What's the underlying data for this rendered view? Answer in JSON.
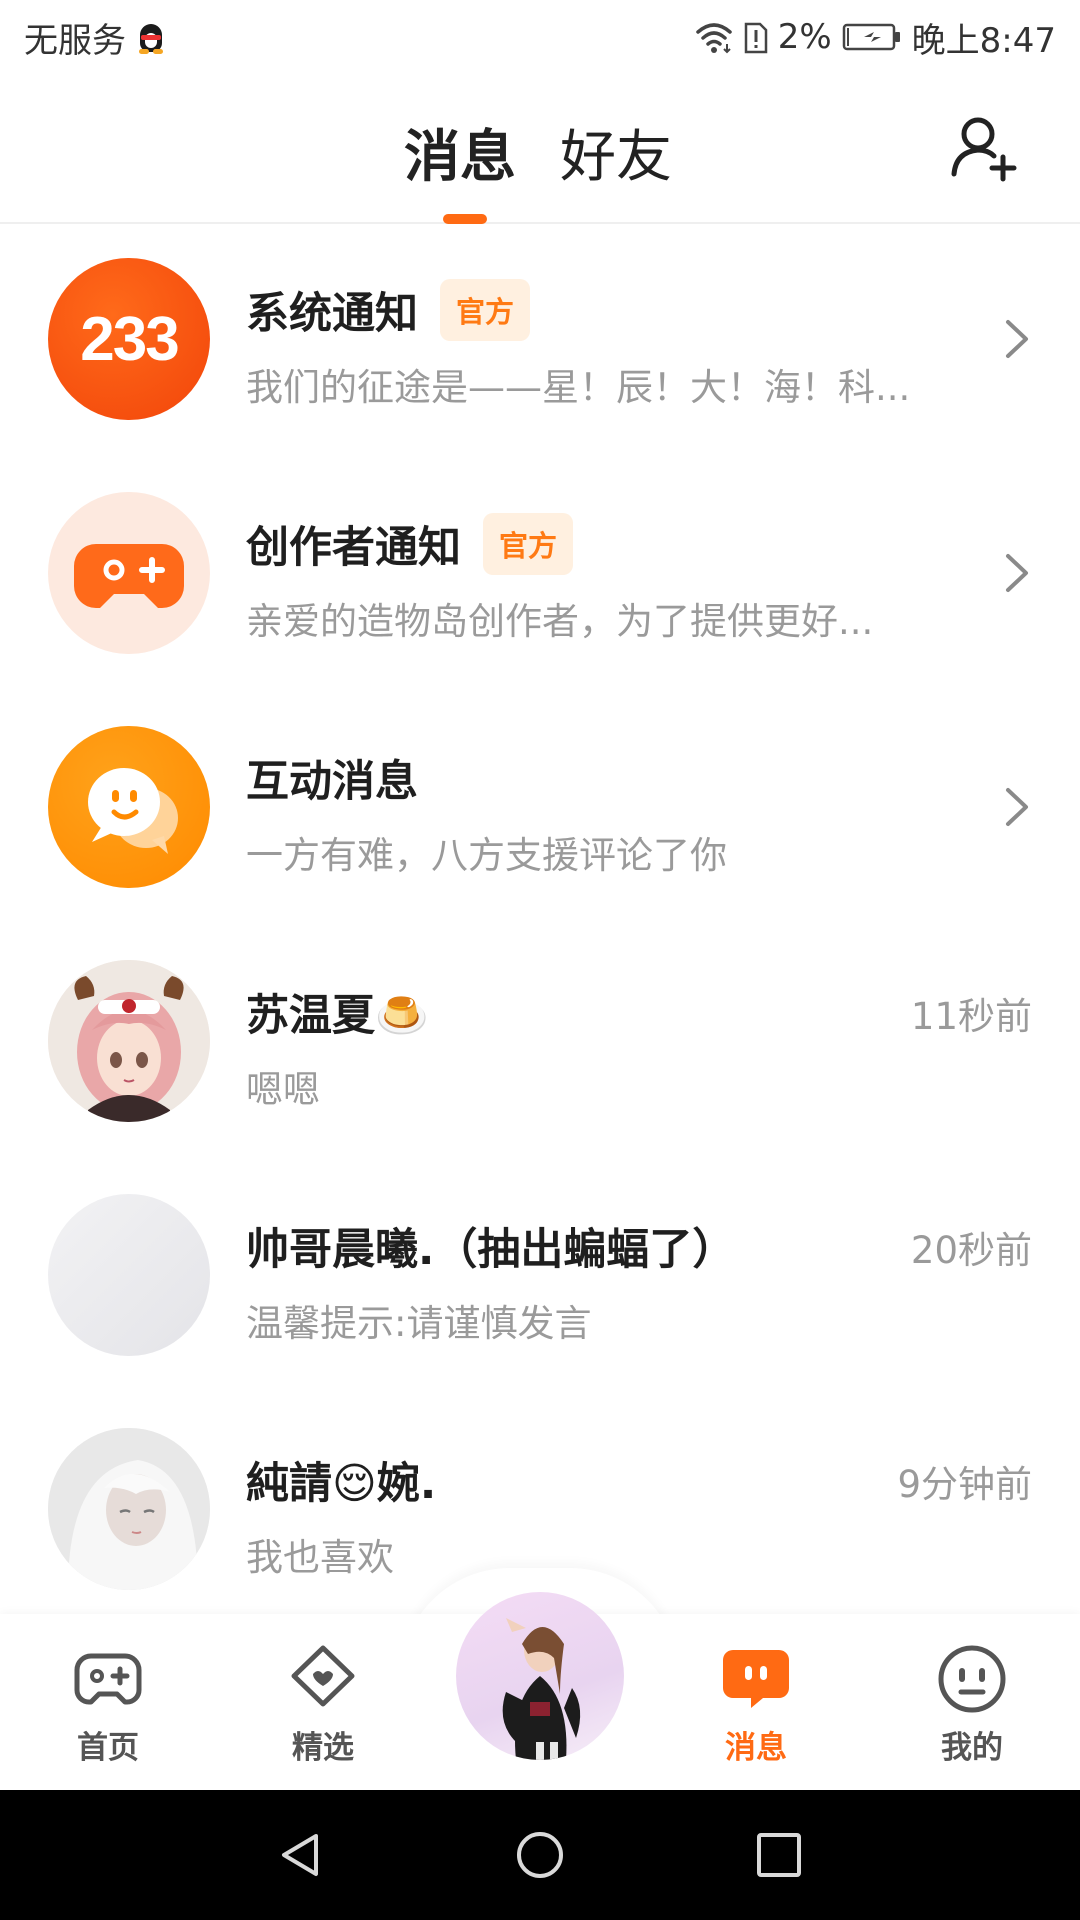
{
  "status_bar": {
    "carrier": "无服务",
    "battery_percent": "2%",
    "time": "晚上8:47"
  },
  "header": {
    "tabs": [
      {
        "label": "消息",
        "active": true
      },
      {
        "label": "好友",
        "active": false
      }
    ],
    "add_friend_icon": "add-friend-icon"
  },
  "colors": {
    "accent": "#ff6a13",
    "badge_bg": "#fff0e0",
    "badge_text": "#ff7a14",
    "subtle_text": "#9a9a9a"
  },
  "conversations": [
    {
      "title": "系统通知",
      "badge": "官方",
      "preview": "我们的征途是——星！辰！大！海！科...",
      "icon": "233-logo",
      "avatar_text": "233",
      "chevron": true
    },
    {
      "title": "创作者通知",
      "badge": "官方",
      "preview": "亲爱的造物岛创作者，为了提供更好...",
      "icon": "gamepad-icon",
      "chevron": true
    },
    {
      "title": "互动消息",
      "preview": "一方有难，八方支援评论了你",
      "icon": "chat-bubble-icon",
      "chevron": true
    },
    {
      "title": "苏温夏🍮",
      "preview": "嗯嗯",
      "time": "11秒前",
      "icon": "anime-girl-avatar"
    },
    {
      "title": "帅哥晨曦.（抽出蝙蝠了）",
      "preview": "温馨提示:请谨慎发言",
      "time": "20秒前",
      "icon": "blank-avatar"
    },
    {
      "title": "純請😌婉.",
      "preview": "我也喜欢",
      "time": "9分钟前",
      "icon": "white-hair-avatar"
    }
  ],
  "bottom_tabs": [
    {
      "label": "首页",
      "icon": "gamepad-icon",
      "active": false
    },
    {
      "label": "精选",
      "icon": "heart-bubble-icon",
      "active": false
    },
    {
      "label": "",
      "icon": "character-avatar",
      "active": false
    },
    {
      "label": "消息",
      "icon": "message-icon",
      "active": true
    },
    {
      "label": "我的",
      "icon": "face-icon",
      "active": false
    }
  ],
  "nav_bar": [
    "back-icon",
    "home-icon",
    "recents-icon"
  ]
}
